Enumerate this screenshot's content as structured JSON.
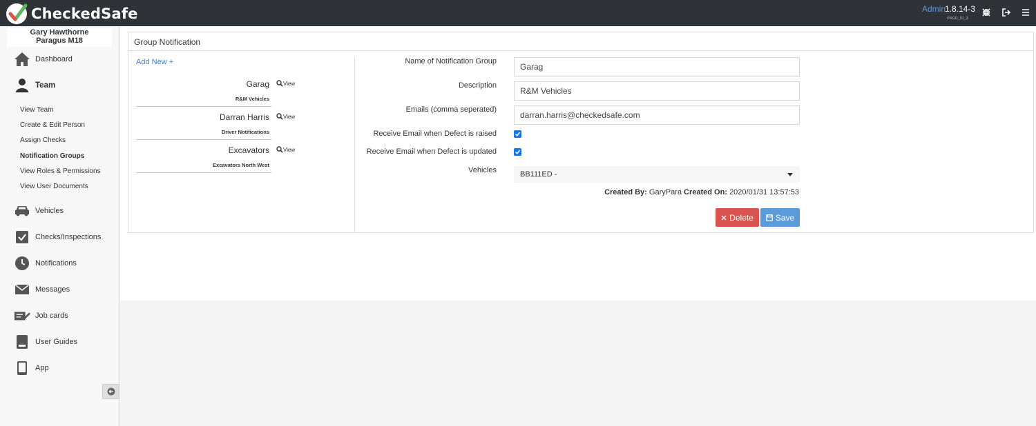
{
  "app": {
    "name": "CheckedSafe"
  },
  "topbar": {
    "admin_label": "Admin",
    "version": "1.8.14-3",
    "build": "PROD_IO_3",
    "icons": [
      "expand-icon",
      "logout-icon",
      "menu-icon"
    ]
  },
  "sidebar": {
    "user_line1": "Gary Hawthorne",
    "user_line2": "Paragus M18",
    "dashboard": "Dashboard",
    "team": "Team",
    "team_sub": [
      "View Team",
      "Create & Edit Person",
      "Assign Checks",
      "Notification Groups",
      "View Roles & Permissions",
      "View User Documents"
    ],
    "vehicles": "Vehicles",
    "checks": "Checks/Inspections",
    "notifications": "Notifications",
    "messages": "Messages",
    "job_cards": "Job cards",
    "user_guides": "User Guides",
    "app": "App"
  },
  "panel": {
    "title": "Group Notification",
    "add_new": "Add New",
    "groups": [
      {
        "name": "Garag",
        "description": "R&M Vehicles",
        "view": "View"
      },
      {
        "name": "Darran Harris",
        "description": "Driver Notifications",
        "view": "View"
      },
      {
        "name": "Excavators",
        "description": "Excavators North West",
        "view": "View"
      }
    ]
  },
  "form": {
    "name_label": "Name of Notification Group",
    "name_value": "Garag",
    "description_label": "Description",
    "description_value": "R&M Vehicles",
    "emails_label": "Emails (comma seperated)",
    "emails_value": "darran.harris@checkedsafe.com",
    "raised_label": "Receive Email when Defect is raised",
    "raised_checked": true,
    "updated_label": "Receive Email when Defect is updated",
    "updated_checked": true,
    "vehicles_label": "Vehicles",
    "vehicles_value": "BB111ED -",
    "created_by_label": "Created By:",
    "created_by_value": "GaryPara",
    "created_on_label": "Created On:",
    "created_on_value": "2020/01/31 13:57:53",
    "delete_label": "Delete",
    "save_label": "Save"
  },
  "colors": {
    "topbar": "#2f3237",
    "link": "#3b7fc4",
    "delete": "#d9534f",
    "save": "#5b9bd9",
    "logo_green": "#5cb85c",
    "logo_red": "#d9534f"
  }
}
